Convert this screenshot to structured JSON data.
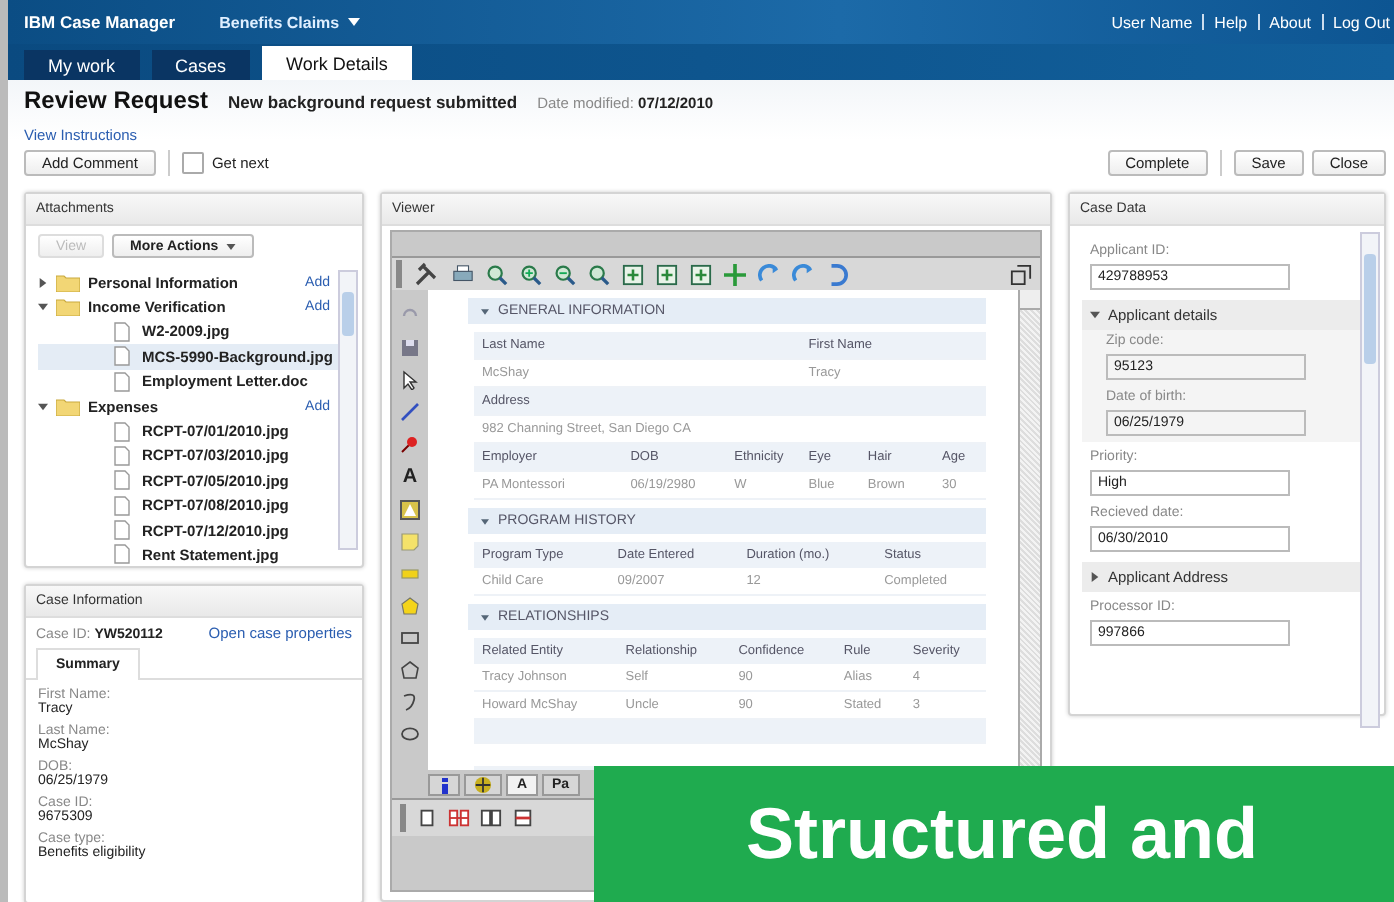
{
  "header": {
    "product": "IBM Case Manager",
    "solution": "Benefits Claims",
    "links": [
      "User Name",
      "Help",
      "About",
      "Log Out"
    ]
  },
  "tabs": [
    {
      "label": "My work",
      "selected": false
    },
    {
      "label": "Cases",
      "selected": false
    },
    {
      "label": "Work Details",
      "selected": true
    }
  ],
  "work_item": {
    "title": "Review Request",
    "subtitle": "New background request submitted",
    "date_label": "Date modified:",
    "date": "07/12/2010",
    "link": "View Instructions"
  },
  "toolbar": {
    "add_comment": "Add Comment",
    "get_next": {
      "label": "Get next",
      "checked": false
    },
    "actions": [
      "Complete",
      "Save",
      "Close"
    ]
  },
  "attachments": {
    "title": "Attachments",
    "buttons": [
      {
        "label": "View",
        "disabled": true
      },
      {
        "label": "More Actions",
        "disabled": false
      }
    ],
    "folders": [
      {
        "name": "Personal Information",
        "expanded": false,
        "add": "Add"
      },
      {
        "name": "Income Verification",
        "expanded": true,
        "add": "Add",
        "files": [
          {
            "name": "W2-2009.jpg",
            "selected": false
          },
          {
            "name": "MCS-5990-Background.jpg",
            "selected": true
          },
          {
            "name": "Employment Letter.doc",
            "selected": false
          }
        ]
      },
      {
        "name": "Expenses",
        "expanded": true,
        "add": "Add",
        "files": [
          {
            "name": "RCPT-07/01/2010.jpg",
            "selected": false
          },
          {
            "name": "RCPT-07/03/2010.jpg",
            "selected": false
          },
          {
            "name": "RCPT-07/05/2010.jpg",
            "selected": false
          },
          {
            "name": "RCPT-07/08/2010.jpg",
            "selected": false
          },
          {
            "name": "RCPT-07/12/2010.jpg",
            "selected": false
          },
          {
            "name": "Rent Statement.jpg",
            "selected": false
          }
        ]
      }
    ]
  },
  "case_info": {
    "title": "Case Information",
    "id_label": "Case ID:",
    "id": "YW520112",
    "link": "Open case properties",
    "tabs": [
      {
        "label": "Summary",
        "selected": true
      }
    ],
    "fields": [
      {
        "label": "First Name:",
        "value": "Tracy"
      },
      {
        "label": "Last Name:",
        "value": "McShay"
      },
      {
        "label": "DOB:",
        "value": "06/25/1979"
      },
      {
        "label": "Case ID:",
        "value": "9675309"
      },
      {
        "label": "Case type:",
        "value": "Benefits eligibility"
      }
    ]
  },
  "viewer": {
    "title": "Viewer",
    "text_tool": "A",
    "sections": [
      {
        "kind": "grid",
        "title": "GENERAL INFORMATION",
        "expanded": true,
        "rows": [
          {
            "header": true,
            "cells": [
              "Last Name",
              "First Name"
            ]
          },
          {
            "header": false,
            "cells": [
              "McShay",
              "Tracy"
            ]
          },
          {
            "header": true,
            "cells": [
              "Address"
            ]
          },
          {
            "header": false,
            "cells": [
              "982 Channing Street, San Diego CA"
            ]
          },
          {
            "header": true,
            "cells": [
              "Employer",
              "DOB",
              "Ethnicity",
              "Eye",
              "Hair",
              "Age"
            ]
          },
          {
            "header": false,
            "cells": [
              "PA Montessori",
              "06/19/2980",
              "W",
              "Blue",
              "Brown",
              "30"
            ]
          }
        ]
      },
      {
        "kind": "table",
        "title": "PROGRAM HISTORY",
        "expanded": true,
        "columns": [
          "Program Type",
          "Date Entered",
          "Duration (mo.)",
          "Status"
        ],
        "rows": [
          [
            "Child Care",
            "09/2007",
            "12",
            "Completed"
          ]
        ]
      },
      {
        "kind": "table",
        "title": "RELATIONSHIPS",
        "expanded": true,
        "columns": [
          "Related Entity",
          "Relationship",
          "Confidence",
          "Rule",
          "Severity"
        ],
        "rows": [
          [
            "Tracy Johnson",
            "Self",
            "90",
            "Alias",
            "4"
          ],
          [
            "Howard McShay",
            "Uncle",
            "90",
            "Stated",
            "3"
          ]
        ]
      }
    ],
    "tabs": [
      {
        "kind": "info",
        "selected": false
      },
      {
        "kind": "tool",
        "selected": false
      },
      {
        "kind": "text",
        "label": "A",
        "selected": true
      },
      {
        "kind": "text",
        "label": "Pa",
        "selected": false
      }
    ]
  },
  "case_data": {
    "title": "Case Data",
    "items": [
      {
        "kind": "field",
        "label": "Applicant ID:",
        "value": "429788953"
      },
      {
        "kind": "group",
        "label": "Applicant details",
        "expanded": true,
        "fields": [
          {
            "label": "Zip code:",
            "value": "95123"
          },
          {
            "label": "Date of birth:",
            "value": "06/25/1979"
          }
        ]
      },
      {
        "kind": "field",
        "label": "Priority:",
        "value": "High"
      },
      {
        "kind": "field",
        "label": "Recieved date:",
        "value": "06/30/2010"
      },
      {
        "kind": "group",
        "label": "Applicant Address",
        "expanded": false
      },
      {
        "kind": "field",
        "label": "Processor ID:",
        "value": "997866"
      }
    ]
  },
  "banner": {
    "text": "Structured and"
  }
}
